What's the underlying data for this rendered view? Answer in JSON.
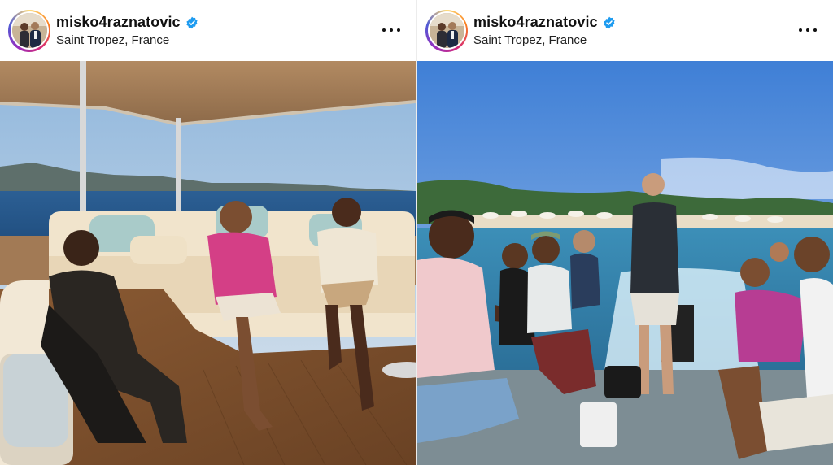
{
  "posts": [
    {
      "username": "misko4raznatovic",
      "location": "Saint Tropez, France",
      "verified": true,
      "photo": "Group seated on the lounge deck of a yacht under a canopy, sea and hills in the background"
    },
    {
      "username": "misko4raznatovic",
      "location": "Saint Tropez, France",
      "verified": true,
      "photo": "Group seated on the stern of a speedboat, beach with umbrellas behind"
    }
  ],
  "icons": {
    "verified": "verified-badge-icon",
    "more": "more-options-icon"
  },
  "colors": {
    "verified_blue": "#1d9bf0",
    "avatar_ring": [
      "#feda75",
      "#fa7e1e",
      "#d62976",
      "#962fbf",
      "#4f5bd5"
    ]
  }
}
